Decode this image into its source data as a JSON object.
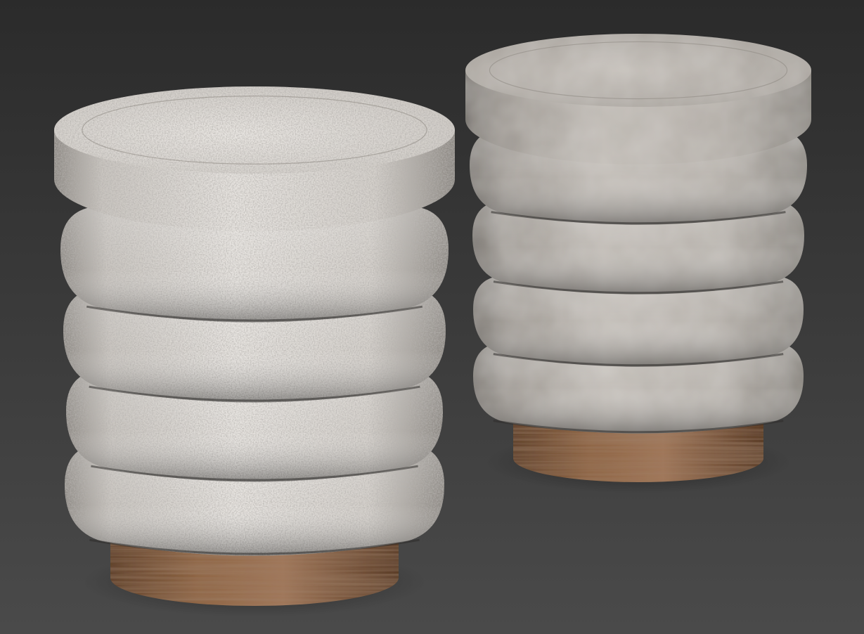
{
  "scene": {
    "background_top": "#2b2b2b",
    "background_bottom": "#4a4a4a"
  },
  "objects": [
    {
      "name": "boucle-ottoman",
      "material": "boucle-fabric",
      "tiers": 4,
      "fabric_color": "#d8d4cf",
      "base_color": "#8a6242"
    },
    {
      "name": "velvet-ottoman",
      "material": "velvet-fabric",
      "tiers": 4,
      "fabric_color": "#b9b4ae",
      "base_color": "#8c6446"
    }
  ]
}
